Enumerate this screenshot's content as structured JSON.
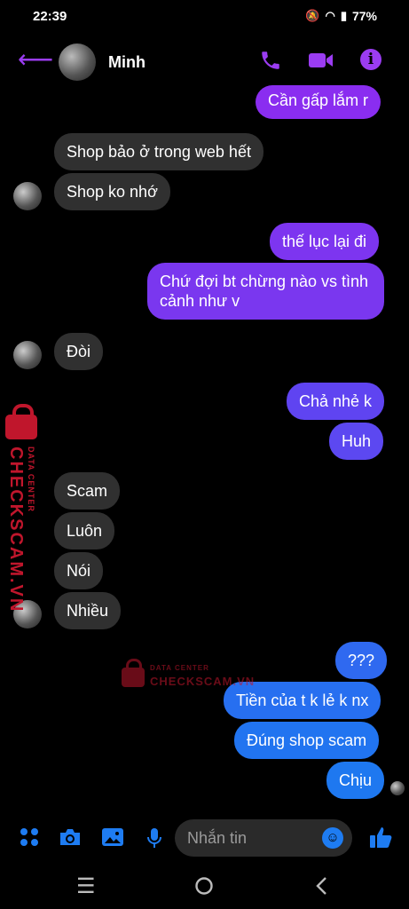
{
  "status": {
    "time": "22:39",
    "battery": "77%"
  },
  "contact": {
    "name": "Minh"
  },
  "messages": [
    {
      "text": "Cần gấp lắm r",
      "dir": "out"
    },
    {
      "text": "Shop bảo ở trong web hết",
      "dir": "in"
    },
    {
      "text": "Shop ko nhớ",
      "dir": "in"
    },
    {
      "text": "thế lục lại đi",
      "dir": "out"
    },
    {
      "text": "Chứ đợi bt chừng nào vs tình",
      "dir": "out"
    },
    {
      "text": "cảnh như v",
      "dir": "out"
    },
    {
      "text": "Đòi",
      "dir": "in"
    },
    {
      "text": "Chả nhẻ k",
      "dir": "out"
    },
    {
      "text": "Huh",
      "dir": "out"
    },
    {
      "text": "Scam",
      "dir": "in"
    },
    {
      "text": "Luôn",
      "dir": "in"
    },
    {
      "text": "Nói",
      "dir": "in"
    },
    {
      "text": "Nhiều",
      "dir": "in"
    },
    {
      "text": "???",
      "dir": "out"
    },
    {
      "text": "Tiền của t k lẻ k nx",
      "dir": "out"
    },
    {
      "text": "Đúng shop scam",
      "dir": "out"
    },
    {
      "text": "Chịu",
      "dir": "out"
    }
  ],
  "watermark": {
    "brand": "CHECKSCAM.VN",
    "tagline": "DATA CENTER"
  },
  "composer": {
    "placeholder": "Nhắn tin"
  },
  "icons": {
    "back": "arrow-left-icon",
    "call": "phone-icon",
    "video": "video-camera-icon",
    "info": "info-icon",
    "apps": "four-dots-icon",
    "camera": "camera-icon",
    "gallery": "image-icon",
    "mic": "microphone-icon",
    "emoji": "emoji-icon",
    "like": "thumbs-up-icon"
  },
  "colors": {
    "accent_purple": "#9b3cf2",
    "accent_blue": "#1e7cf2",
    "incoming_bubble": "#303030",
    "watermark": "#c0162c"
  }
}
